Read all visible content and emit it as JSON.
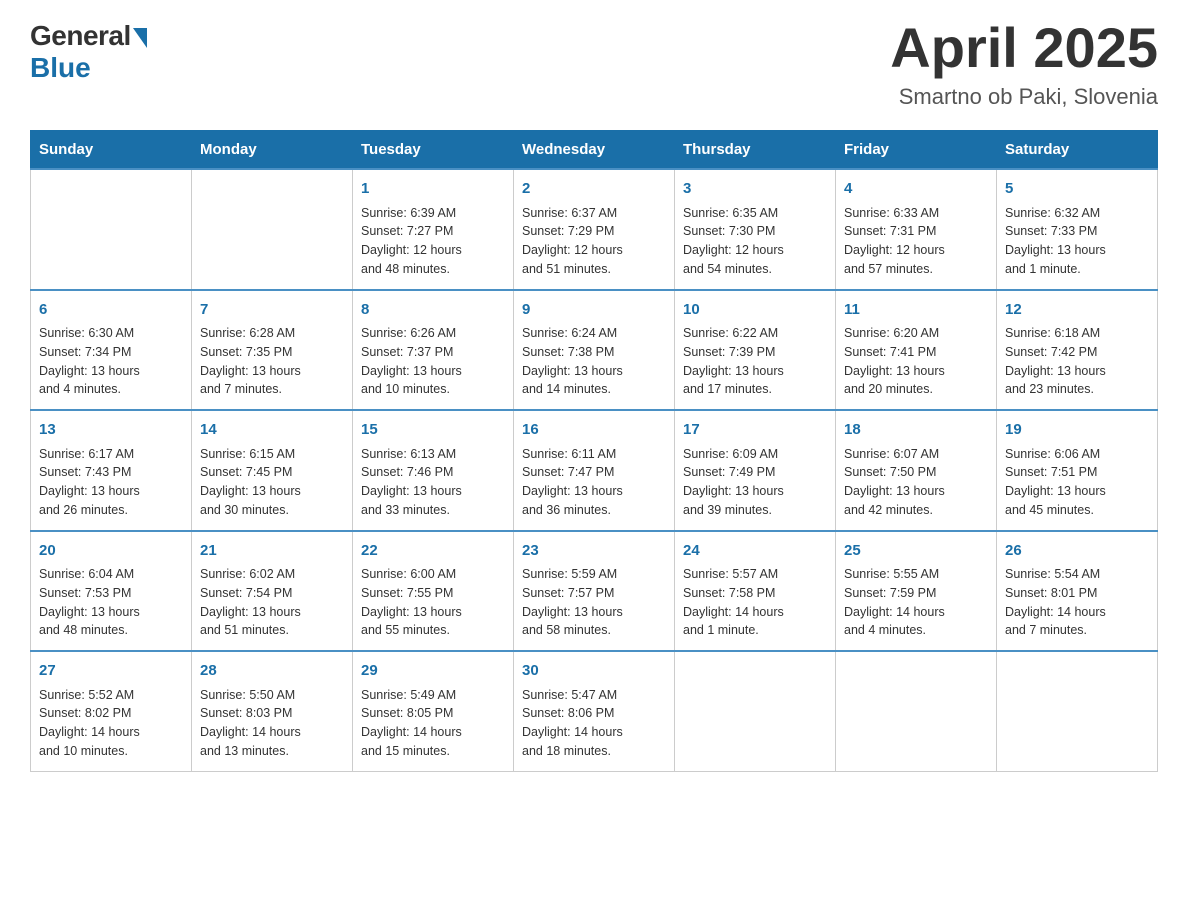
{
  "logo": {
    "general": "General",
    "blue": "Blue"
  },
  "title": "April 2025",
  "location": "Smartno ob Paki, Slovenia",
  "days": [
    "Sunday",
    "Monday",
    "Tuesday",
    "Wednesday",
    "Thursday",
    "Friday",
    "Saturday"
  ],
  "weeks": [
    [
      {
        "day": "",
        "info": ""
      },
      {
        "day": "",
        "info": ""
      },
      {
        "day": "1",
        "info": "Sunrise: 6:39 AM\nSunset: 7:27 PM\nDaylight: 12 hours\nand 48 minutes."
      },
      {
        "day": "2",
        "info": "Sunrise: 6:37 AM\nSunset: 7:29 PM\nDaylight: 12 hours\nand 51 minutes."
      },
      {
        "day": "3",
        "info": "Sunrise: 6:35 AM\nSunset: 7:30 PM\nDaylight: 12 hours\nand 54 minutes."
      },
      {
        "day": "4",
        "info": "Sunrise: 6:33 AM\nSunset: 7:31 PM\nDaylight: 12 hours\nand 57 minutes."
      },
      {
        "day": "5",
        "info": "Sunrise: 6:32 AM\nSunset: 7:33 PM\nDaylight: 13 hours\nand 1 minute."
      }
    ],
    [
      {
        "day": "6",
        "info": "Sunrise: 6:30 AM\nSunset: 7:34 PM\nDaylight: 13 hours\nand 4 minutes."
      },
      {
        "day": "7",
        "info": "Sunrise: 6:28 AM\nSunset: 7:35 PM\nDaylight: 13 hours\nand 7 minutes."
      },
      {
        "day": "8",
        "info": "Sunrise: 6:26 AM\nSunset: 7:37 PM\nDaylight: 13 hours\nand 10 minutes."
      },
      {
        "day": "9",
        "info": "Sunrise: 6:24 AM\nSunset: 7:38 PM\nDaylight: 13 hours\nand 14 minutes."
      },
      {
        "day": "10",
        "info": "Sunrise: 6:22 AM\nSunset: 7:39 PM\nDaylight: 13 hours\nand 17 minutes."
      },
      {
        "day": "11",
        "info": "Sunrise: 6:20 AM\nSunset: 7:41 PM\nDaylight: 13 hours\nand 20 minutes."
      },
      {
        "day": "12",
        "info": "Sunrise: 6:18 AM\nSunset: 7:42 PM\nDaylight: 13 hours\nand 23 minutes."
      }
    ],
    [
      {
        "day": "13",
        "info": "Sunrise: 6:17 AM\nSunset: 7:43 PM\nDaylight: 13 hours\nand 26 minutes."
      },
      {
        "day": "14",
        "info": "Sunrise: 6:15 AM\nSunset: 7:45 PM\nDaylight: 13 hours\nand 30 minutes."
      },
      {
        "day": "15",
        "info": "Sunrise: 6:13 AM\nSunset: 7:46 PM\nDaylight: 13 hours\nand 33 minutes."
      },
      {
        "day": "16",
        "info": "Sunrise: 6:11 AM\nSunset: 7:47 PM\nDaylight: 13 hours\nand 36 minutes."
      },
      {
        "day": "17",
        "info": "Sunrise: 6:09 AM\nSunset: 7:49 PM\nDaylight: 13 hours\nand 39 minutes."
      },
      {
        "day": "18",
        "info": "Sunrise: 6:07 AM\nSunset: 7:50 PM\nDaylight: 13 hours\nand 42 minutes."
      },
      {
        "day": "19",
        "info": "Sunrise: 6:06 AM\nSunset: 7:51 PM\nDaylight: 13 hours\nand 45 minutes."
      }
    ],
    [
      {
        "day": "20",
        "info": "Sunrise: 6:04 AM\nSunset: 7:53 PM\nDaylight: 13 hours\nand 48 minutes."
      },
      {
        "day": "21",
        "info": "Sunrise: 6:02 AM\nSunset: 7:54 PM\nDaylight: 13 hours\nand 51 minutes."
      },
      {
        "day": "22",
        "info": "Sunrise: 6:00 AM\nSunset: 7:55 PM\nDaylight: 13 hours\nand 55 minutes."
      },
      {
        "day": "23",
        "info": "Sunrise: 5:59 AM\nSunset: 7:57 PM\nDaylight: 13 hours\nand 58 minutes."
      },
      {
        "day": "24",
        "info": "Sunrise: 5:57 AM\nSunset: 7:58 PM\nDaylight: 14 hours\nand 1 minute."
      },
      {
        "day": "25",
        "info": "Sunrise: 5:55 AM\nSunset: 7:59 PM\nDaylight: 14 hours\nand 4 minutes."
      },
      {
        "day": "26",
        "info": "Sunrise: 5:54 AM\nSunset: 8:01 PM\nDaylight: 14 hours\nand 7 minutes."
      }
    ],
    [
      {
        "day": "27",
        "info": "Sunrise: 5:52 AM\nSunset: 8:02 PM\nDaylight: 14 hours\nand 10 minutes."
      },
      {
        "day": "28",
        "info": "Sunrise: 5:50 AM\nSunset: 8:03 PM\nDaylight: 14 hours\nand 13 minutes."
      },
      {
        "day": "29",
        "info": "Sunrise: 5:49 AM\nSunset: 8:05 PM\nDaylight: 14 hours\nand 15 minutes."
      },
      {
        "day": "30",
        "info": "Sunrise: 5:47 AM\nSunset: 8:06 PM\nDaylight: 14 hours\nand 18 minutes."
      },
      {
        "day": "",
        "info": ""
      },
      {
        "day": "",
        "info": ""
      },
      {
        "day": "",
        "info": ""
      }
    ]
  ]
}
